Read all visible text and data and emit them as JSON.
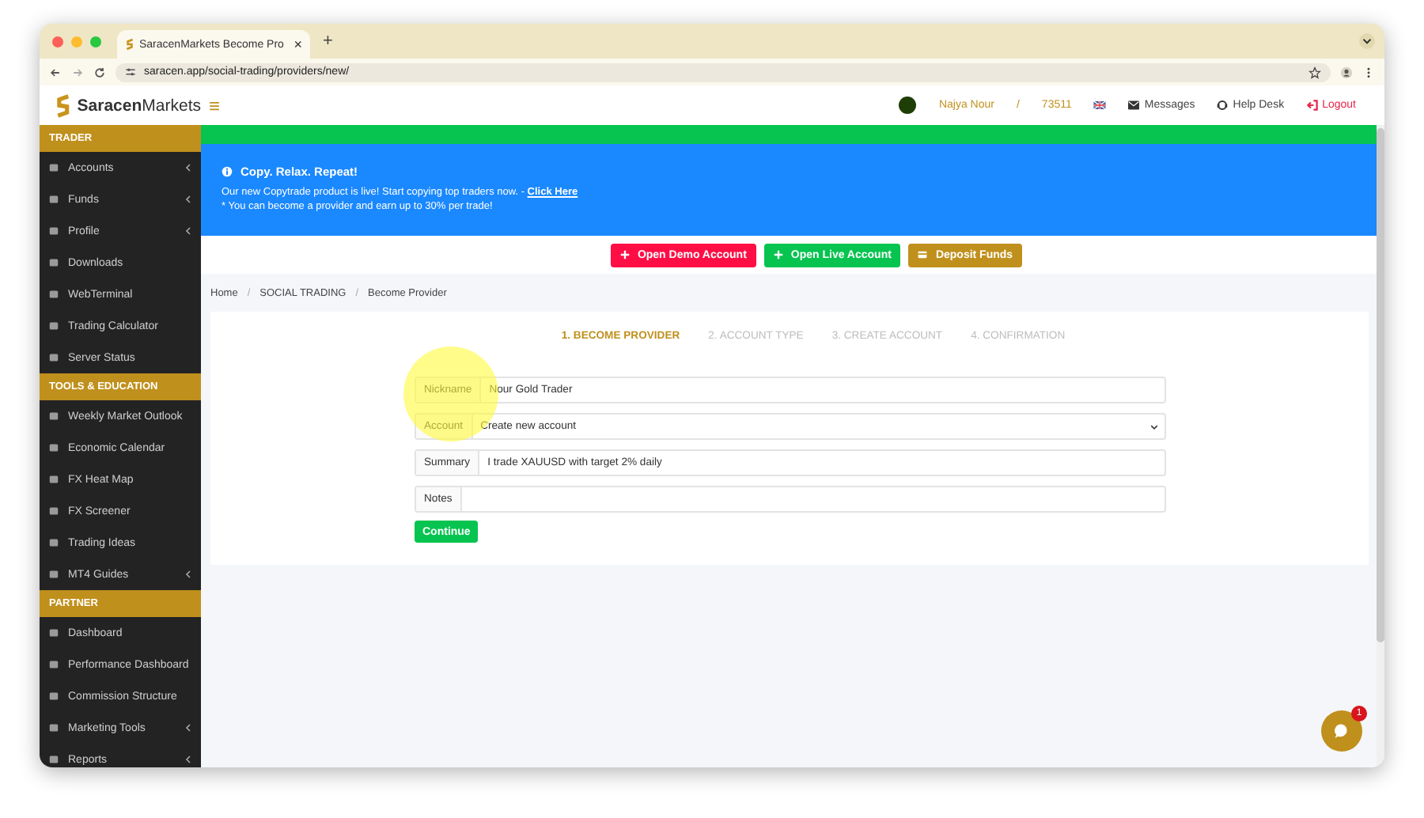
{
  "browser": {
    "tab_title": "SaracenMarkets Become Pro",
    "tab_close": "×",
    "new_tab": "+",
    "url": "saracen.app/social-trading/providers/new/"
  },
  "header": {
    "logo_bold": "Saracen",
    "logo_light": "Markets",
    "menu_toggle": "≡",
    "user_name": "Najya Nour",
    "separator": "/",
    "account_id": "73511",
    "messages": "Messages",
    "help": "Help Desk",
    "logout": "Logout"
  },
  "sidebar": [
    {
      "title": "TRADER",
      "items": [
        {
          "label": "Accounts",
          "has_submenu": true
        },
        {
          "label": "Funds",
          "has_submenu": true
        },
        {
          "label": "Profile",
          "has_submenu": true
        },
        {
          "label": "Downloads",
          "has_submenu": false
        },
        {
          "label": "WebTerminal",
          "has_submenu": false
        },
        {
          "label": "Trading Calculator",
          "has_submenu": false
        },
        {
          "label": "Server Status",
          "has_submenu": false
        }
      ]
    },
    {
      "title": "TOOLS & EDUCATION",
      "items": [
        {
          "label": "Weekly Market Outlook",
          "has_submenu": false
        },
        {
          "label": "Economic Calendar",
          "has_submenu": false
        },
        {
          "label": "FX Heat Map",
          "has_submenu": false
        },
        {
          "label": "FX Screener",
          "has_submenu": false
        },
        {
          "label": "Trading Ideas",
          "has_submenu": false
        },
        {
          "label": "MT4 Guides",
          "has_submenu": true
        }
      ]
    },
    {
      "title": "PARTNER",
      "items": [
        {
          "label": "Dashboard",
          "has_submenu": false
        },
        {
          "label": "Performance Dashboard",
          "has_submenu": false
        },
        {
          "label": "Commission Structure",
          "has_submenu": false
        },
        {
          "label": "Marketing Tools",
          "has_submenu": true
        },
        {
          "label": "Reports",
          "has_submenu": true
        }
      ]
    }
  ],
  "alert": {
    "title": "Copy. Relax. Repeat!",
    "line_1": "Our new Copytrade product is live! Start copying top traders now. -",
    "link": "Click Here",
    "line_2": "* You can become a provider and earn up to 30% per trade!"
  },
  "actions": [
    {
      "label": "Open Demo Account",
      "kind": "demo"
    },
    {
      "label": "Open Live Account",
      "kind": "live"
    },
    {
      "label": "Deposit Funds",
      "kind": "deposit"
    }
  ],
  "breadcrumb": [
    "Home",
    "SOCIAL TRADING",
    "Become Provider"
  ],
  "breadcrumb_separator": "/",
  "steps": [
    {
      "label": "1. BECOME PROVIDER",
      "selected": true
    },
    {
      "label": "2. ACCOUNT TYPE",
      "selected": false
    },
    {
      "label": "3. CREATE ACCOUNT",
      "selected": false
    },
    {
      "label": "4. CONFIRMATION",
      "selected": false
    }
  ],
  "form": [
    {
      "label": "Nickname",
      "value": "Nour Gold Trader",
      "kind": "text"
    },
    {
      "label": "Account",
      "value": "Create new account",
      "kind": "select"
    },
    {
      "label": "Summary",
      "value": "I trade XAUUSD with target 2% daily",
      "kind": "text"
    },
    {
      "label": "Notes",
      "kind": "text"
    }
  ],
  "submit": "Continue",
  "chat": {
    "badge": "1"
  }
}
